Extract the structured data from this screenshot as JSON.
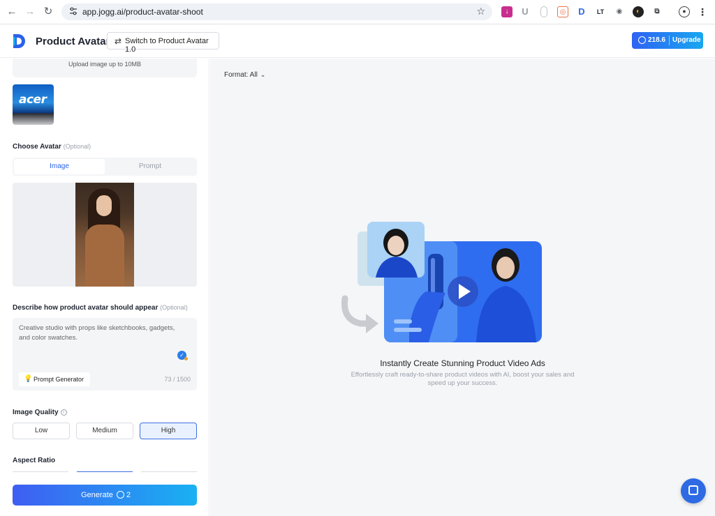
{
  "browser": {
    "url": "app.jogg.ai/product-avatar-shoot"
  },
  "header": {
    "brand": "Product Avatar",
    "switch_label": "Switch to Product Avatar 1.0",
    "credits": "218.6",
    "upgrade_label": "Upgrade"
  },
  "left": {
    "upload_hint": "Upload image up to 10MB",
    "thumb_brand": "acer",
    "choose_avatar": "Choose Avatar",
    "optional": "(Optional)",
    "tabs": [
      "Image",
      "Prompt"
    ],
    "describe_label": "Describe how product avatar should appear",
    "describe_text": "Creative studio with props like sketchbooks, gadgets, and color swatches.",
    "prompt_generator": "Prompt Generator",
    "char_count": "73 / 1500",
    "image_quality": "Image Quality",
    "quality_options": [
      "Low",
      "Medium",
      "High"
    ],
    "quality_selected": "High",
    "aspect_ratio": "Aspect Ratio",
    "generate_label": "Generate",
    "generate_cost": "2"
  },
  "main": {
    "format_label": "Format: All",
    "empty_title": "Instantly Create Stunning Product Video Ads",
    "empty_subtitle": "Effortlessly craft ready-to-share product videos with AI, boost your sales and speed up your success."
  },
  "colors": {
    "accent": "#2a62e8",
    "generate_start": "#3f5ef2",
    "generate_end": "#19b1f2"
  }
}
